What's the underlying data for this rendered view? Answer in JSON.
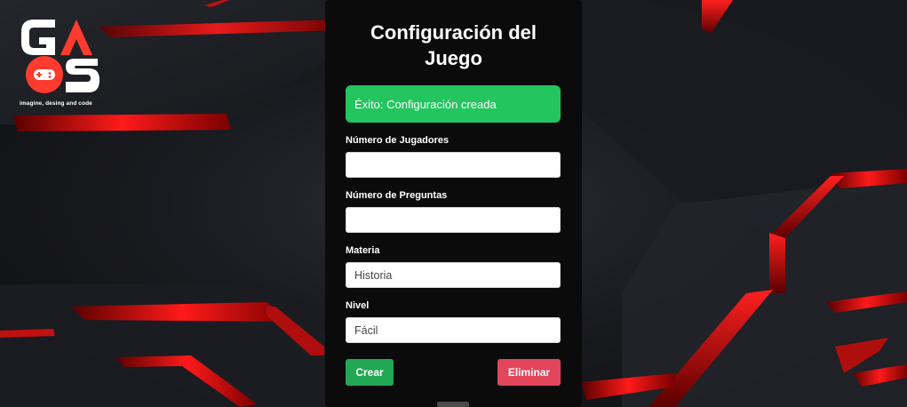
{
  "logo": {
    "text": "GAOS",
    "tagline": "imagine, desing and code"
  },
  "form": {
    "title": "Configuración del Juego",
    "alert": "Éxito: Configuración creada",
    "fields": [
      {
        "label": "Número de Jugadores",
        "value": ""
      },
      {
        "label": "Número de Preguntas",
        "value": ""
      },
      {
        "label": "Materia",
        "value": "Historia"
      },
      {
        "label": "Nivel",
        "value": "Fácil"
      }
    ],
    "create_label": "Crear",
    "delete_label": "Eliminar"
  },
  "colors": {
    "accent_red": "#e02424",
    "success": "#22c55e",
    "create_button": "#22a755",
    "delete_button": "#e3455a",
    "panel": "#0b0b0c"
  }
}
